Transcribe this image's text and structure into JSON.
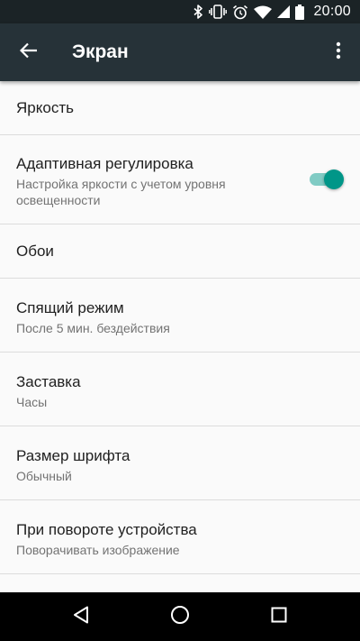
{
  "status_bar": {
    "time": "20:00",
    "icons": [
      "bluetooth-icon",
      "vibrate-icon",
      "alarm-icon",
      "wifi-icon",
      "cell-signal-icon",
      "battery-icon"
    ]
  },
  "app_bar": {
    "title": "Экран",
    "back_icon": "arrow-back-icon",
    "menu_icon": "more-vert-icon"
  },
  "settings": {
    "brightness": {
      "title": "Яркость"
    },
    "adaptive": {
      "title": "Адаптивная регулировка",
      "summary": "Настройка яркости с учетом уровня освещенности",
      "enabled": true
    },
    "wallpaper": {
      "title": "Обои"
    },
    "sleep": {
      "title": "Спящий режим",
      "summary": "После 5 мин. бездействия"
    },
    "screensaver": {
      "title": "Заставка",
      "summary": "Часы"
    },
    "font_size": {
      "title": "Размер шрифта",
      "summary": "Обычный"
    },
    "rotation": {
      "title": "При повороте устройства",
      "summary": "Поворачивать изображение"
    }
  },
  "nav_bar": {
    "icons": [
      "nav-back-icon",
      "nav-home-icon",
      "nav-recents-icon"
    ]
  },
  "colors": {
    "status_bar": "#1b2326",
    "app_bar": "#263238",
    "background": "#fafafa",
    "accent": "#009688",
    "accent_track": "#80cbc4",
    "divider": "#dcdcdc"
  }
}
